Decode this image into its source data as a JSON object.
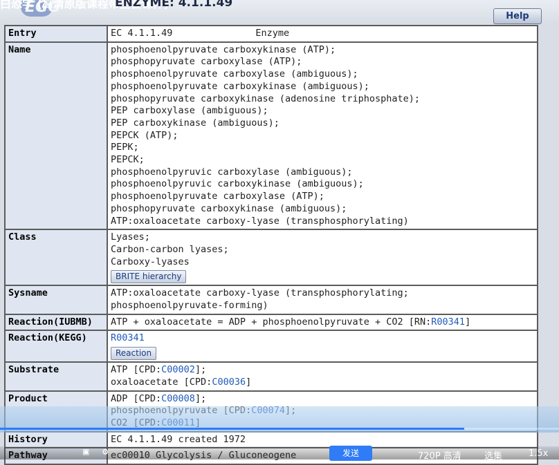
{
  "header": {
    "overlay_title": "白恐学  (高清原版课程带全套课件)",
    "logo_text": "EGG",
    "page_title": "ENZYME: 4.1.1.49",
    "help_label": "Help"
  },
  "entry": {
    "label": "Entry",
    "ec": "EC 4.1.1.49",
    "type": "Enzyme"
  },
  "name": {
    "label": "Name",
    "lines": [
      "phosphoenolpyruvate carboxykinase (ATP);",
      "phosphopyruvate carboxylase (ATP);",
      "phosphoenolpyruvate carboxylase (ambiguous);",
      "phosphoenolpyruvate carboxykinase (ambiguous);",
      "phosphopyruvate carboxykinase (adenosine triphosphate);",
      "PEP carboxylase (ambiguous);",
      "PEP carboxykinase (ambiguous);",
      "PEPCK (ATP);",
      "PEPK;",
      "PEPCK;",
      "phosphoenolpyruvic carboxylase (ambiguous);",
      "phosphoenolpyruvic carboxykinase (ambiguous);",
      "phosphoenolpyruvate carboxylase (ATP);",
      "phosphopyruvate carboxykinase (ambiguous);",
      "ATP:oxaloacetate carboxy-lyase (transphosphorylating)"
    ]
  },
  "class": {
    "label": "Class",
    "lines": [
      "Lyases;",
      "Carbon-carbon lyases;",
      "Carboxy-lyases"
    ],
    "button": "BRITE hierarchy"
  },
  "sysname": {
    "label": "Sysname",
    "lines": [
      "ATP:oxaloacetate carboxy-lyase (transphosphorylating;",
      "phosphoenolpyruvate-forming)"
    ]
  },
  "reaction_iubmb": {
    "label": "Reaction(IUBMB)",
    "text": "ATP + oxaloacetate = ADP + phosphoenolpyruvate + CO2 [RN:",
    "link": "R00341",
    "close": "]"
  },
  "reaction_kegg": {
    "label": "Reaction(KEGG)",
    "link": "R00341",
    "button": "Reaction"
  },
  "substrate": {
    "label": "Substrate",
    "items": [
      {
        "pre": "ATP [CPD:",
        "id": "C00002",
        "post": "];"
      },
      {
        "pre": "oxaloacetate [CPD:",
        "id": "C00036",
        "post": "]"
      }
    ]
  },
  "product": {
    "label": "Product",
    "items": [
      {
        "pre": "ADP [CPD:",
        "id": "C00008",
        "post": "];"
      },
      {
        "pre": "phosphoenolpyruvate [CPD:",
        "id": "C00074",
        "post": "];"
      },
      {
        "pre": "CO2 [CPD:",
        "id": "C00011",
        "post": "]"
      }
    ]
  },
  "history": {
    "label": "History",
    "text": "EC 4.1.1.49 created 1972"
  },
  "pathway": {
    "label": "Pathway",
    "text": "ec00010  Glycolysis / Gluconeogene"
  },
  "player": {
    "progress": 0.83,
    "send_label": "发送",
    "quality": "720P 高清",
    "episodes": "选集",
    "speed": "1.5x",
    "accent": "#2f7cf6"
  }
}
